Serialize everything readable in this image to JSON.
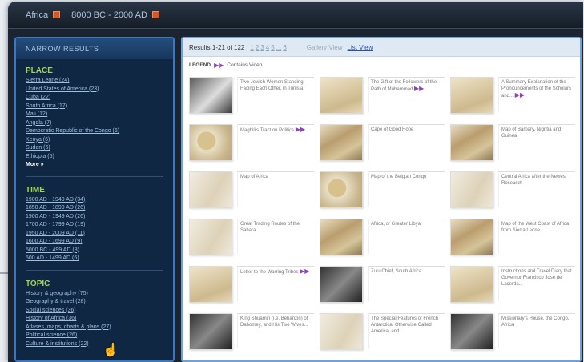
{
  "breadcrumbs": [
    "Africa",
    "8000 BC - 2000 AD"
  ],
  "sidebar": {
    "header": "NARROW RESULTS",
    "facets": [
      {
        "title": "PLACE",
        "items": [
          "Sierra Leone (24)",
          "United States of America (23)",
          "Cuba (22)",
          "South Africa (17)",
          "Mali (12)",
          "Angola (7)",
          "Democratic Republic of the Congo (6)",
          "Kenya (6)",
          "Sudan (6)",
          "Ethiopia (5)"
        ],
        "more": "More »"
      },
      {
        "title": "TIME",
        "items": [
          "1900 AD - 1949 AD (34)",
          "1850 AD - 1899 AD (26)",
          "1900 AD - 1949 AD (26)",
          "1700 AD - 1799 AD (19)",
          "1950 AD - 2009 AD (11)",
          "1600 AD - 1699 AD (9)",
          "5000 BC - 499 AD (8)",
          "500 AD - 1499 AD (6)"
        ]
      },
      {
        "title": "TOPIC",
        "items": [
          "History & geography (75)",
          "Geography & travel (28)",
          "Social sciences (36)",
          "History of Africa (36)",
          "Atlases, maps, charts & plans (27)",
          "Political science (26)",
          "Culture & institutions (22)"
        ]
      }
    ]
  },
  "results": {
    "label": "Results 1-21 of 122",
    "pages": [
      "1",
      "2",
      "3",
      "4",
      "5",
      "...",
      "6"
    ],
    "gallery_view": "Gallery View",
    "list_view": "List View"
  },
  "legend": {
    "label": "LEGEND",
    "item": "Contains Video"
  },
  "items": [
    {
      "caption": "Two Jewish Women Standing, Facing Each Other, in Tunisia",
      "thumb": "t-photo",
      "video": false
    },
    {
      "caption": "The Gift of the Followers of the Path of Muhammad",
      "thumb": "t-paper",
      "video": true
    },
    {
      "caption": "A Summary Explanation of the Pronouncements of the Scholars and...",
      "thumb": "t-paper",
      "video": true
    },
    {
      "caption": "Maghili's Tract on Politics",
      "thumb": "t-map",
      "video": true
    },
    {
      "caption": "Cape of Good Hope",
      "thumb": "t-mixed",
      "video": false
    },
    {
      "caption": "Map of Barbary, Nigritia and Guinea",
      "thumb": "t-mixed",
      "video": false
    },
    {
      "caption": "Map of Africa",
      "thumb": "t-old",
      "video": false
    },
    {
      "caption": "Map of the Belgian Congo",
      "thumb": "t-map",
      "video": false
    },
    {
      "caption": "Central Africa after the Newest Research",
      "thumb": "t-old",
      "video": false
    },
    {
      "caption": "Great Trading Routes of the Sahara",
      "thumb": "t-old",
      "video": false
    },
    {
      "caption": "Africa, or Greater Libya",
      "thumb": "t-mixed",
      "video": false
    },
    {
      "caption": "Map of the West Coast of Africa from Sierra Leone",
      "thumb": "t-mixed",
      "video": false
    },
    {
      "caption": "Letter to the Warring Tribes",
      "thumb": "t-paper",
      "video": true
    },
    {
      "caption": "Zulu Chief, South Africa",
      "thumb": "t-dark",
      "video": false
    },
    {
      "caption": "Instructions and Travel Diary that Governor Francisco Jose de Lacerda...",
      "thumb": "t-paper",
      "video": false
    },
    {
      "caption": "King Shuamin (i.e. Behanzin) of Dahomey, and His Two Wives...",
      "thumb": "t-dark",
      "video": false
    },
    {
      "caption": "The Special Features of French Antarctica, Otherwise Called America, and...",
      "thumb": "t-old",
      "video": false
    },
    {
      "caption": "Missionary's House, the Congo, Africa",
      "thumb": "t-dark",
      "video": false
    }
  ]
}
